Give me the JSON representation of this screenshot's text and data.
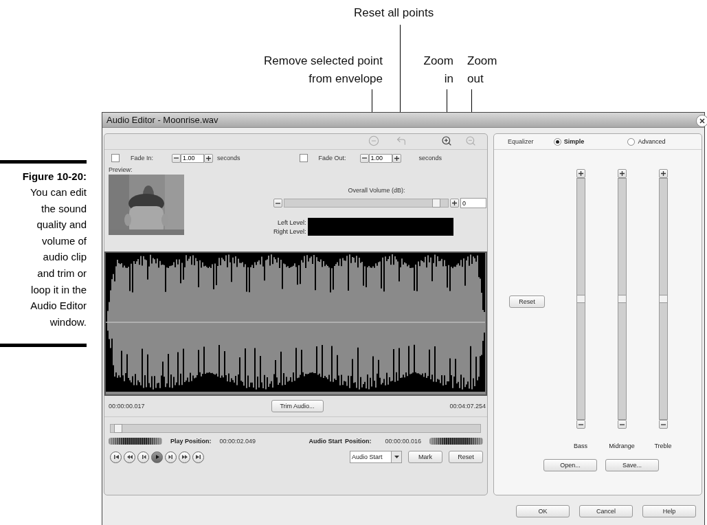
{
  "callouts": [
    {
      "kind": "reset_points",
      "text": "Reset all points"
    },
    {
      "kind": "remove_point",
      "text": "Remove selected point\nfrom envelope"
    },
    {
      "kind": "zoom_in",
      "text": "Zoom\nin"
    },
    {
      "kind": "zoom_out",
      "text": "Zoom\nout"
    }
  ],
  "caption": {
    "figure": "Figure 10-20:",
    "text": "You can edit\nthe sound\nquality and\nvolume of\naudio clip\nand trim or\nloop it in the\nAudio Editor\nwindow."
  },
  "window": {
    "title": "Audio Editor - Moonrise.wav"
  },
  "toolbar": [
    {
      "kind": "remove_point",
      "disabled": true
    },
    {
      "kind": "reset_points",
      "disabled": true
    },
    {
      "kind": "zoom_in",
      "disabled": false
    },
    {
      "kind": "zoom_out",
      "disabled": true
    }
  ],
  "fades": [
    {
      "label": "Fade In:",
      "checked": false,
      "value": "1.00",
      "unit": "seconds"
    },
    {
      "label": "Fade Out:",
      "checked": false,
      "value": "1.00",
      "unit": "seconds"
    }
  ],
  "preview": {
    "label": "Preview:",
    "kind": "picture"
  },
  "volume": {
    "label": "Overall Volume (dB):",
    "level": 0.93,
    "value": "0"
  },
  "levels": [
    {
      "label": "Left Level:"
    },
    {
      "label": "Right Level:"
    }
  ],
  "waveform": {
    "start": "00:00:00.017",
    "end": "00:04:07.254",
    "trim_button": "Trim Audio..."
  },
  "position_slider": {
    "level": 0.02
  },
  "play_position": {
    "label": "Play Position:",
    "value": "00:00:02.049"
  },
  "audio_start": {
    "label": "Audio Start",
    "label_2": "Position:",
    "value": "00:00:00.016"
  },
  "transport": [
    {
      "kind": "first",
      "selected": false
    },
    {
      "kind": "rewind",
      "selected": false
    },
    {
      "kind": "step_back",
      "selected": false
    },
    {
      "kind": "play",
      "selected": true
    },
    {
      "kind": "step_forward",
      "selected": false
    },
    {
      "kind": "fast_forward",
      "selected": false
    },
    {
      "kind": "last",
      "selected": false
    }
  ],
  "marker": {
    "dropdown": "Audio Start",
    "buttons": [
      "Mark",
      "Reset"
    ]
  },
  "equalizer": {
    "label": "Equalizer",
    "modes": [
      {
        "label": "Simple",
        "selected": true
      },
      {
        "label": "Advanced",
        "selected": false
      }
    ],
    "reset_button": "Reset",
    "bands": [
      {
        "label": "Bass",
        "level": 0.5
      },
      {
        "label": "Midrange",
        "level": 0.5
      },
      {
        "label": "Treble",
        "level": 0.5
      }
    ],
    "buttons": [
      "Open...",
      "Save..."
    ]
  },
  "dialog_buttons": [
    "OK",
    "Cancel",
    "Help"
  ]
}
